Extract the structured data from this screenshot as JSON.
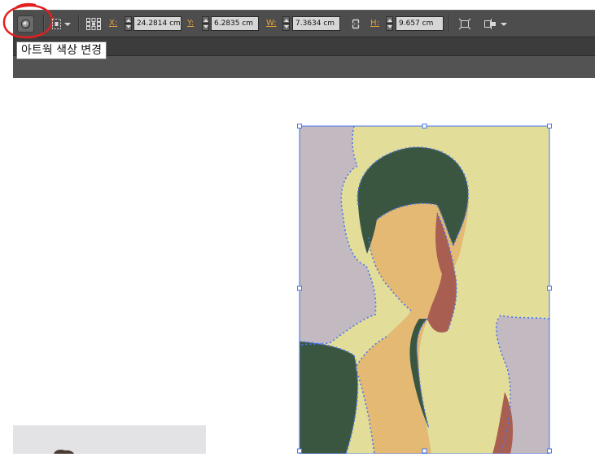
{
  "toolbar": {
    "x_label": "X:",
    "x_value": "24.2814 cm",
    "y_label": "Y:",
    "y_value": "6.2835 cm",
    "w_label": "W:",
    "w_value": "7.3634 cm",
    "h_label": "H:",
    "h_value": "9.657 cm"
  },
  "tooltip": {
    "text": "아트웍 색상 변경"
  },
  "icons": [
    "recolor-artwork-icon",
    "transform-reference-icon",
    "reference-point-icon",
    "constrain-proportions-icon",
    "isolate-icon",
    "align-options-icon"
  ],
  "colors": {
    "control_bar": "#4d4d4d",
    "field_label": "#e8a23b",
    "highlight_circle": "#e0201e",
    "path_stroke": "#4a76ef",
    "bg_lavender": "#c3b9c1",
    "bg_yellow": "#e2dd98",
    "hair_green": "#3a5640",
    "skin": "#e4b973",
    "shadow_red": "#a95e52"
  }
}
